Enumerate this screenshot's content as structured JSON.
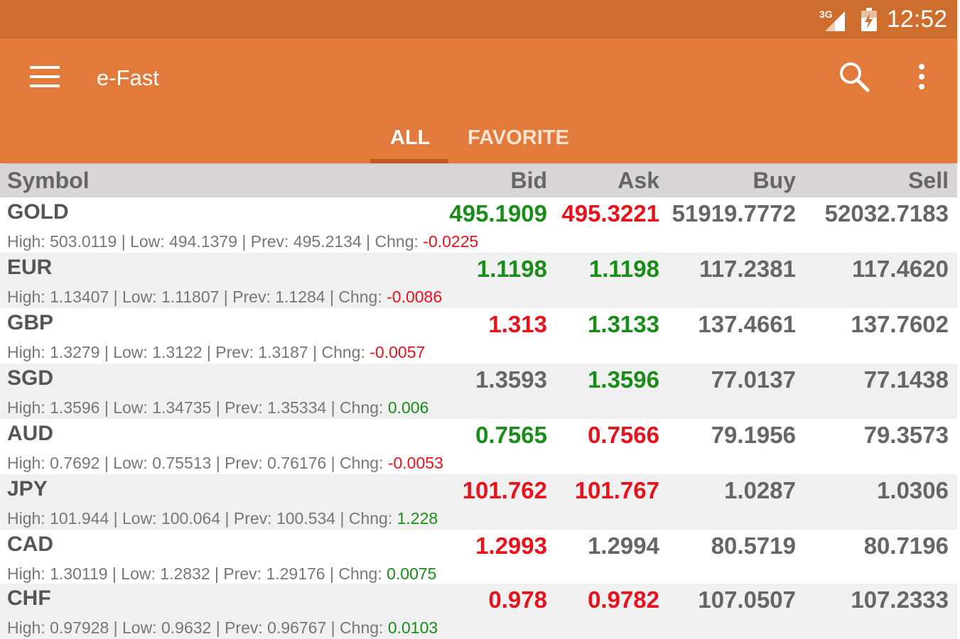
{
  "status_bar": {
    "network": "3G",
    "time": "12:52"
  },
  "app_bar": {
    "title": "e-Fast",
    "icons": [
      "menu-icon",
      "search-icon",
      "more-vert-icon"
    ]
  },
  "tabs": [
    {
      "label": "ALL",
      "selected": true
    },
    {
      "label": "FAVORITE",
      "selected": false
    }
  ],
  "table": {
    "columns": {
      "symbol": "Symbol",
      "bid": "Bid",
      "ask": "Ask",
      "buy": "Buy",
      "sell": "Sell"
    },
    "labels": {
      "high": "High: ",
      "low": " | Low: ",
      "prev": " | Prev: ",
      "chng": " | Chng: "
    },
    "rows": [
      {
        "symbol": "GOLD",
        "bid": "495.1909",
        "ask": "495.3221",
        "buy": "51919.7772",
        "sell": "52032.7183",
        "high": "503.0119",
        "low": "494.1379",
        "prev": "495.2134",
        "chng": "-0.0225"
      },
      {
        "symbol": "EUR",
        "bid": "1.1198",
        "ask": "1.1198",
        "buy": "117.2381",
        "sell": "117.4620",
        "high": "1.13407",
        "low": "1.11807",
        "prev": "1.1284",
        "chng": "-0.0086"
      },
      {
        "symbol": "GBP",
        "bid": "1.313",
        "ask": "1.3133",
        "buy": "137.4661",
        "sell": "137.7602",
        "high": "1.3279",
        "low": "1.3122",
        "prev": "1.3187",
        "chng": "-0.0057"
      },
      {
        "symbol": "SGD",
        "bid": "1.3593",
        "ask": "1.3596",
        "buy": "77.0137",
        "sell": "77.1438",
        "high": "1.3596",
        "low": "1.34735",
        "prev": "1.35334",
        "chng": "0.006"
      },
      {
        "symbol": "AUD",
        "bid": "0.7565",
        "ask": "0.7566",
        "buy": "79.1956",
        "sell": "79.3573",
        "high": "0.7692",
        "low": "0.75513",
        "prev": "0.76176",
        "chng": "-0.0053"
      },
      {
        "symbol": "JPY",
        "bid": "101.762",
        "ask": "101.767",
        "buy": "1.0287",
        "sell": "1.0306",
        "high": "101.944",
        "low": "100.064",
        "prev": "100.534",
        "chng": "1.228"
      },
      {
        "symbol": "CAD",
        "bid": "1.2993",
        "ask": "1.2994",
        "buy": "80.5719",
        "sell": "80.7196",
        "high": "1.30119",
        "low": "1.2832",
        "prev": "1.29176",
        "chng": "0.0075"
      },
      {
        "symbol": "CHF",
        "bid": "0.978",
        "ask": "0.9782",
        "buy": "107.0507",
        "sell": "107.2333",
        "high": "0.97928",
        "low": "0.9632",
        "prev": "0.96767",
        "chng": "0.0103"
      }
    ],
    "price_colors": {
      "up": "#1a8c1a",
      "down": "#e8121c",
      "unchanged": "#666666"
    },
    "bid_state": [
      "up",
      "up",
      "down",
      "unchanged",
      "up",
      "down",
      "down",
      "down"
    ],
    "ask_state": [
      "down",
      "up",
      "up",
      "up",
      "down",
      "down",
      "unchanged",
      "down"
    ]
  },
  "colors": {
    "status_bar": "#cd6d2e",
    "app_bar": "#e17a3a",
    "tab_indicator": "#c4581c",
    "header_bg": "#d8d6d6",
    "row_alt": "#f0f0f0"
  }
}
